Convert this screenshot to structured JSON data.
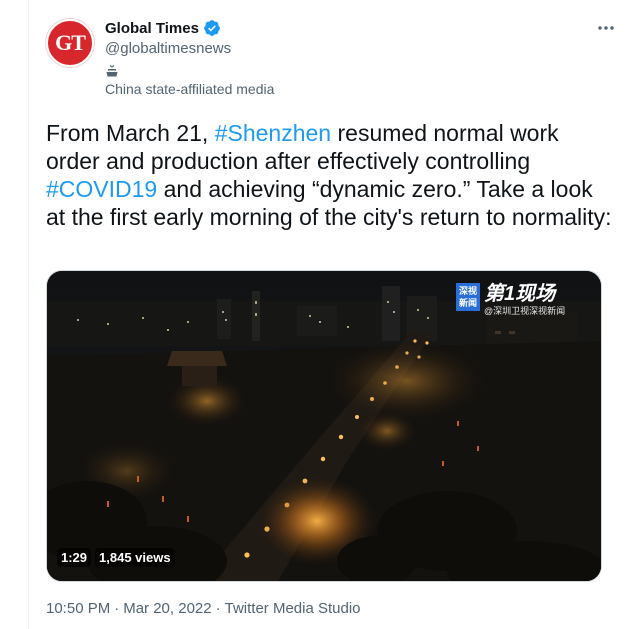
{
  "account": {
    "avatar_text": "GT",
    "display_name": "Global Times",
    "handle": "@globaltimesnews",
    "affiliation": "China state-affiliated media",
    "verified_icon": "verified-badge-icon",
    "label_icon": "podium-icon"
  },
  "tweet": {
    "text_parts": {
      "p1": "From March 21, ",
      "tag1": "#Shenzhen",
      "p2": " resumed normal work order and production after effectively controlling ",
      "tag2": "#COVID19",
      "p3": " and achieving “dynamic zero.” Take a look at the first early morning of the city's return to normality:"
    }
  },
  "media": {
    "type": "video",
    "duration": "1:29",
    "views": "1,845 views",
    "watermark_box": "深视新闻",
    "watermark_main": "第1现场",
    "watermark_sub": "@深圳卫视深视新闻"
  },
  "meta": {
    "time": "10:50 PM",
    "separator1": "·",
    "date": "Mar 20, 2022",
    "separator2": "·",
    "source": "Twitter Media Studio"
  },
  "colors": {
    "accent": "#1d9bf0",
    "secondary_text": "#536471",
    "avatar_bg": "#d8262d"
  }
}
